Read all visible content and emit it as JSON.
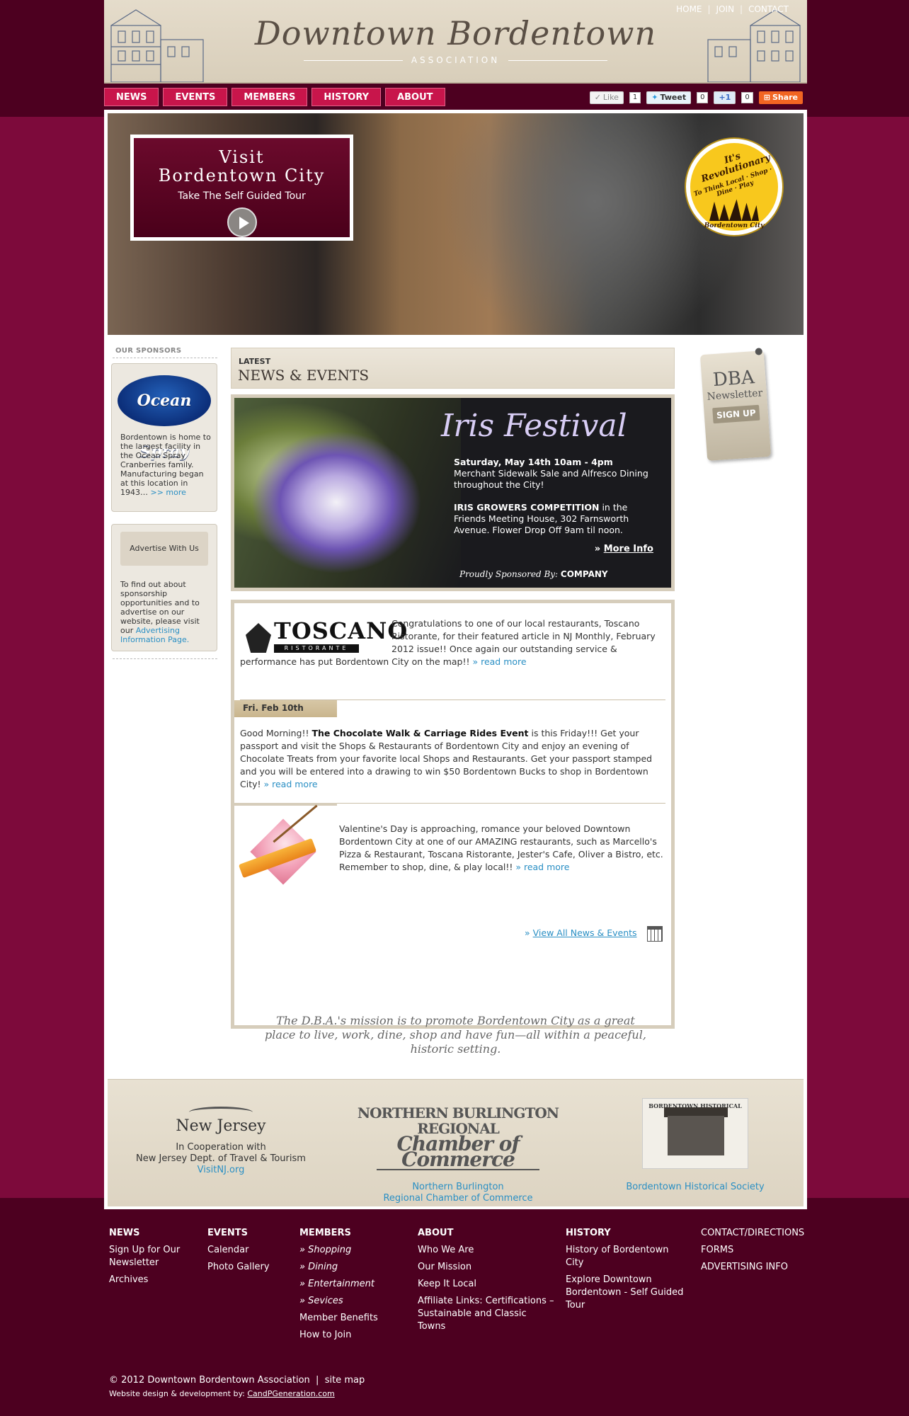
{
  "header": {
    "title": "Downtown Bordentown",
    "subtitle": "ASSOCIATION",
    "top_links": [
      "HOME",
      "JOIN",
      "CONTACT"
    ]
  },
  "nav": {
    "tabs": [
      "NEWS",
      "EVENTS",
      "MEMBERS",
      "HISTORY",
      "ABOUT"
    ]
  },
  "social": {
    "like_label": "Like",
    "like_count": "1",
    "tweet_label": "Tweet",
    "tweet_count": "0",
    "plus_label": "+1",
    "plus_count": "0",
    "share_label": "Share"
  },
  "hero": {
    "box_title_1": "Visit",
    "box_title_2": "Bordentown City",
    "box_subtitle": "Take The Self Guided Tour",
    "badge_line_1": "It's Revolutionary",
    "badge_line_2": "To Think Local · Shop · Dine · Play",
    "badge_line_3": "Bordentown City"
  },
  "sidebar": {
    "sponsors_title": "OUR SPONSORS",
    "ocean_spray_logo": "Ocean Spray",
    "sponsor_text": "Bordentown is home to the largest facility in the Ocean Spray Cranberries family. Manufacturing began at this location in 1943…",
    "sponsor_more": ">> more",
    "advertise_button": "Advertise With Us",
    "advertise_text": "To find out about sponsorship opportunities and to advertise on our website, please visit our",
    "advertise_link": "Advertising Information Page."
  },
  "news": {
    "latest_label": "LATEST",
    "section_title": "NEWS & EVENTS",
    "iris": {
      "title": "Iris Festival",
      "date_line": "Saturday, May 14th 10am - 4pm",
      "sidewalk": "Merchant Sidewalk Sale and Alfresco Dining throughout the City!",
      "competition_bold": "IRIS GROWERS COMPETITION",
      "competition_rest": " in the Friends Meeting House, 302 Farnsworth Avenue. Flower Drop Off 9am til noon.",
      "more_prefix": "» ",
      "more_label": "More Info",
      "sponsored_label": "Proudly Sponsored By:",
      "sponsor_name": "COMPANY"
    },
    "toscano": {
      "logo_text": "TOSCANO",
      "logo_sub": "RISTORANTE",
      "text": "Congratulations to one of our local restaurants, Toscano Ristorante, for their featured article in NJ Monthly, February 2012 issue!! Once again our outstanding service & performance has put Bordentown City on the map!!",
      "read_more": "» read more"
    },
    "chocolate": {
      "date": "Fri. Feb 10th",
      "text_a": "Good Morning!! ",
      "text_bold": "The Chocolate Walk & Carriage Rides Event",
      "text_b": " is this Friday!!! Get your passport and visit the Shops & Restaurants of Bordentown City and enjoy an evening of Chocolate Treats from your favorite local Shops and Restaurants. Get your passport stamped and you will be entered into a drawing to win $50 Bordentown Bucks to shop in Bordentown City!",
      "read_more": "» read more"
    },
    "valentine": {
      "text": "Valentine's Day is approaching, romance your beloved Downtown Bordentown City at one of our AMAZING restaurants, such as Marcello's Pizza & Restaurant, Toscana Ristorante, Jester's Cafe, Oliver a Bistro, etc. Remember to shop, dine, & play local!!",
      "read_more": "» read more"
    },
    "view_all_prefix": "» ",
    "view_all": "View All News & Events"
  },
  "newsletter": {
    "line1": "DBA",
    "line2": "Newsletter",
    "button": "SIGN UP"
  },
  "mission": "The D.B.A.'s mission is to promote Bordentown City as a great place to live, work, dine, shop and have fun—all within a peaceful, historic setting.",
  "partners": {
    "nj": {
      "logo": "New Jersey",
      "line1": "In Cooperation with",
      "line2": "New Jersey Dept. of Travel & Tourism",
      "link": "VisitNJ.org"
    },
    "chamber": {
      "logo_line1": "NORTHERN BURLINGTON REGIONAL",
      "logo_line2": "Chamber of Commerce",
      "link_1": "Northern Burlington",
      "link_2": "Regional Chamber of Commerce"
    },
    "historical": {
      "logo": "BORDENTOWN HISTORICAL SOCIETY",
      "link": "Bordentown Historical Society"
    }
  },
  "footer": {
    "news": {
      "heading": "NEWS",
      "items": [
        "Sign Up for Our Newsletter",
        "Archives"
      ]
    },
    "events": {
      "heading": "EVENTS",
      "items": [
        "Calendar",
        "Photo Gallery"
      ]
    },
    "members": {
      "heading": "MEMBERS",
      "items": [
        "» Shopping",
        "» Dining",
        "» Entertainment",
        "» Sevices",
        "Member Benefits",
        "How to Join"
      ]
    },
    "about": {
      "heading": "ABOUT",
      "items": [
        "Who We Are",
        "Our Mission",
        "Keep It Local",
        "Affiliate Links: Certifications – Sustainable and Classic Towns"
      ]
    },
    "history": {
      "heading": "HISTORY",
      "items": [
        "History of Bordentown City",
        "Explore Downtown Bordentown - Self Guided Tour"
      ]
    },
    "misc": {
      "items": [
        "CONTACT/DIRECTIONS",
        "FORMS",
        "ADVERTISING INFO"
      ]
    },
    "copyright": "© 2012 Downtown Bordentown Association  |  site map",
    "credit_prefix": "Website design & development by: ",
    "credit_link": "CandPGeneration.com"
  },
  "colors": {
    "page_bg": "#7d0a3b",
    "dark_band": "#4d0020",
    "nav_tab": "#c8154b",
    "link": "#2a8fc4",
    "panel_tan": "#d6cdbb"
  }
}
